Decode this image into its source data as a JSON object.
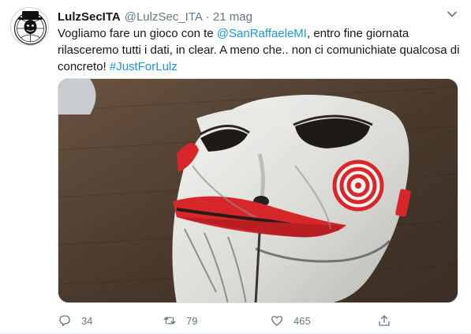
{
  "tweet": {
    "author_name": "LulzSecITA",
    "author_handle": "@LulzSec_ITA",
    "separator": "·",
    "date": "21 mag",
    "text_part1": "Vogliamo fare un gioco con te ",
    "mention": "@SanRaffaeleMI",
    "text_part2": ", entro fine giornata rilasceremo tutti i dati, in clear. A meno che.. non ci comunichiate qualcosa di concreto! ",
    "hashtag": "#JustForLulz"
  },
  "media": {
    "description_icon": "jigsaw-mask-photo"
  },
  "actions": {
    "reply_count": "34",
    "retweet_count": "79",
    "like_count": "465"
  },
  "colors": {
    "link": "#1b95e0",
    "muted": "#657786",
    "text": "#14171a"
  },
  "icons": [
    "avatar-mask-logo",
    "chevron-down-icon",
    "reply-icon",
    "retweet-icon",
    "like-icon",
    "share-icon"
  ]
}
